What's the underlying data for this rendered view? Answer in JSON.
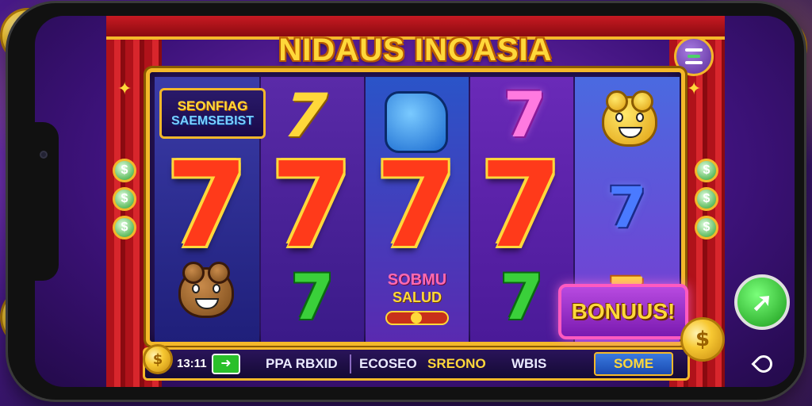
{
  "game": {
    "title": "NIDAUS INOASIA",
    "sign_line1": "SEONFIAG",
    "sign_line2": "SAEMSEBIST",
    "bonus_label": "BONUUS!",
    "mini_sign_line1": "SOBMU",
    "mini_sign_line2": "SALUD"
  },
  "reels": {
    "symbol": "7",
    "dollar": "$"
  },
  "controls": {
    "time": "13:11",
    "label_a": "PPA RBXID",
    "label_b": "ECOSEO",
    "label_c": "SREONO",
    "label_d": "WBIS",
    "button_label": "SOME"
  },
  "colors": {
    "accent_gold": "#f4b82a",
    "reel_frame": "#f4b82a",
    "seven_red": "#ff3a1a",
    "bonus_purple": "#b84ae0",
    "spin_green": "#2ac02a"
  },
  "icons": {
    "menu": "hamburger-icon",
    "spin": "arrow-icon",
    "location": "pin-icon",
    "dollar_lamp": "dollar-icon"
  }
}
